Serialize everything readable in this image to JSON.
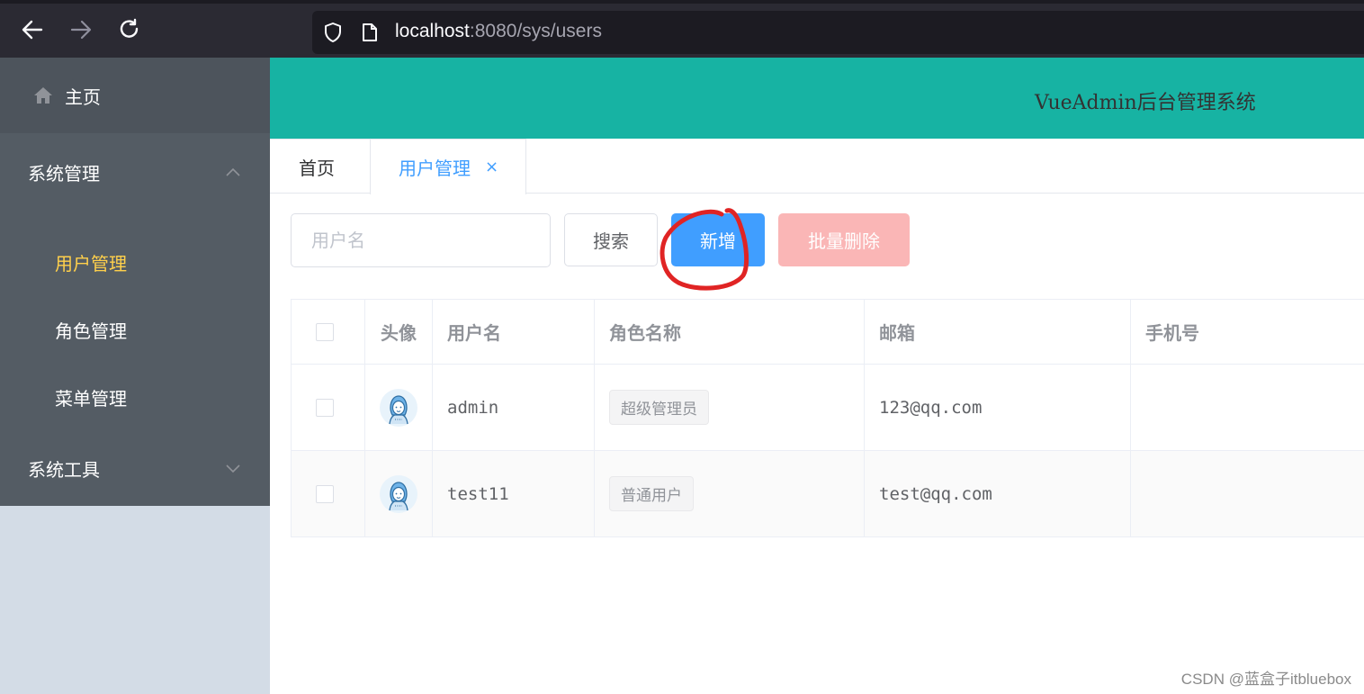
{
  "browser": {
    "url_host": "localhost",
    "url_rest": ":8080/sys/users"
  },
  "sidebar": {
    "home_label": "主页",
    "system_label": "系统管理",
    "items": [
      {
        "label": "用户管理",
        "active": true
      },
      {
        "label": "角色管理",
        "active": false
      },
      {
        "label": "菜单管理",
        "active": false
      }
    ],
    "tools_label": "系统工具"
  },
  "header": {
    "title": "VueAdmin后台管理系统"
  },
  "tabs": [
    {
      "label": "首页",
      "active": false
    },
    {
      "label": "用户管理",
      "active": true,
      "close": "×"
    }
  ],
  "toolbar": {
    "search_placeholder": "用户名",
    "search_label": "搜索",
    "add_label": "新增",
    "batch_delete_label": "批量删除"
  },
  "table": {
    "columns": [
      "头像",
      "用户名",
      "角色名称",
      "邮箱",
      "手机号"
    ],
    "rows": [
      {
        "username": "admin",
        "role": "超级管理员",
        "email": "123@qq.com",
        "phone": ""
      },
      {
        "username": "test11",
        "role": "普通用户",
        "email": "test@qq.com",
        "phone": ""
      }
    ]
  },
  "watermark": "CSDN @蓝盒子itbluebox",
  "colors": {
    "header_bg": "#17b3a3",
    "sidebar_bg": "#545c64",
    "active_menu": "#ffd04b",
    "primary": "#409eff",
    "danger_disabled": "#fab6b6",
    "annotation": "#e02424"
  }
}
